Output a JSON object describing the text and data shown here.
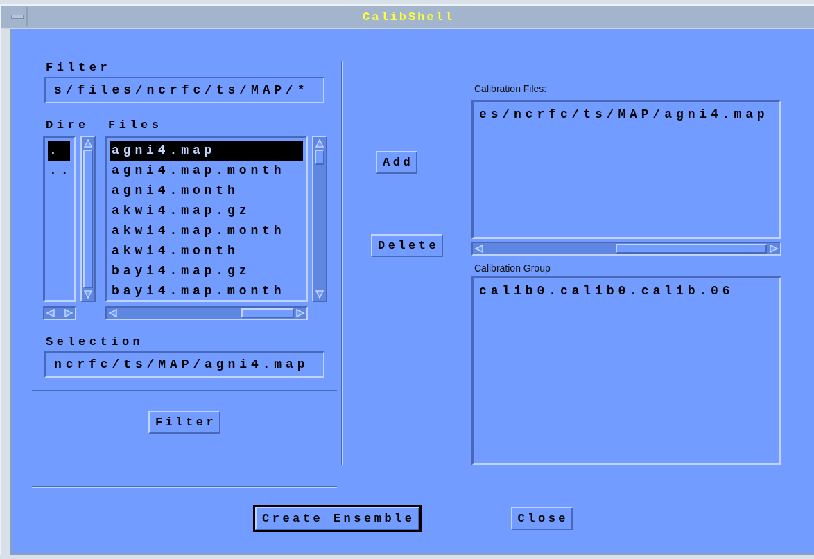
{
  "window": {
    "title": "CalibShell"
  },
  "filter": {
    "label": "Filter",
    "value": "s/files/ncrfc/ts/MAP/*"
  },
  "directories": {
    "label": "Dire",
    "items": [
      {
        "text": ".",
        "selected": true
      },
      {
        "text": "..",
        "selected": false
      }
    ]
  },
  "files": {
    "label": "Files",
    "items": [
      {
        "text": "agni4.map",
        "selected": true
      },
      {
        "text": "agni4.map.month",
        "selected": false
      },
      {
        "text": "agni4.month",
        "selected": false
      },
      {
        "text": "akwi4.map.gz",
        "selected": false
      },
      {
        "text": "akwi4.map.month",
        "selected": false
      },
      {
        "text": "akwi4.month",
        "selected": false
      },
      {
        "text": "bayi4.map.gz",
        "selected": false
      },
      {
        "text": "bayi4.map.month",
        "selected": false
      }
    ]
  },
  "selection": {
    "label": "Selection",
    "value": "ncrfc/ts/MAP/agni4.map"
  },
  "filter_button": "Filter",
  "add_button": "Add",
  "delete_button": "Delete",
  "calibration_files": {
    "label": "Calibration Files:",
    "items": [
      "es/ncrfc/ts/MAP/agni4.map"
    ]
  },
  "calibration_group": {
    "label": "Calibration Group",
    "items": [
      "calib0.calib0.calib.06"
    ]
  },
  "bottom_buttons": [
    {
      "label": "Create Ensemble",
      "default": true
    },
    {
      "label": "Close",
      "default": false
    }
  ]
}
